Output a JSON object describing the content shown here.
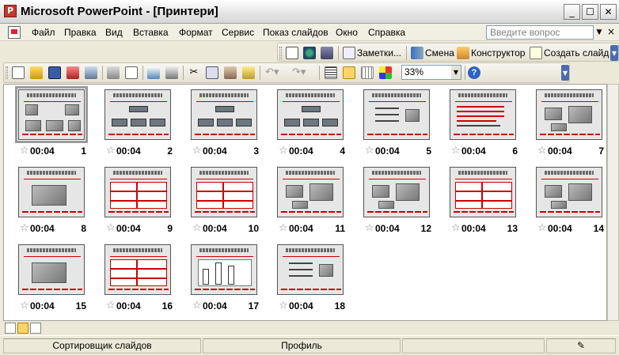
{
  "window": {
    "title": "Microsoft PowerPoint - [Принтери]",
    "app_icon": "P"
  },
  "menu": {
    "items": [
      "Файл",
      "Правка",
      "Вид",
      "Вставка",
      "Формат",
      "Сервис",
      "Показ слайдов",
      "Окно",
      "Справка"
    ],
    "help_placeholder": "Введите вопрос"
  },
  "toolbar1": {
    "notes_label": "Заметки...",
    "change_label": "Смена",
    "designer_label": "Конструктор",
    "new_slide_label": "Создать слайд"
  },
  "toolbar2": {
    "zoom": "33%"
  },
  "slides": [
    {
      "num": "1",
      "time": "00:04"
    },
    {
      "num": "2",
      "time": "00:04"
    },
    {
      "num": "3",
      "time": "00:04"
    },
    {
      "num": "4",
      "time": "00:04"
    },
    {
      "num": "5",
      "time": "00:04"
    },
    {
      "num": "6",
      "time": "00:04"
    },
    {
      "num": "7",
      "time": "00:04"
    },
    {
      "num": "8",
      "time": "00:04"
    },
    {
      "num": "9",
      "time": "00:04"
    },
    {
      "num": "10",
      "time": "00:04"
    },
    {
      "num": "11",
      "time": "00:04"
    },
    {
      "num": "12",
      "time": "00:04"
    },
    {
      "num": "13",
      "time": "00:04"
    },
    {
      "num": "14",
      "time": "00:04"
    },
    {
      "num": "15",
      "time": "00:04"
    },
    {
      "num": "16",
      "time": "00:04"
    },
    {
      "num": "17",
      "time": "00:04"
    },
    {
      "num": "18",
      "time": "00:04"
    }
  ],
  "status": {
    "view": "Сортировщик слайдов",
    "template": "Профиль"
  }
}
